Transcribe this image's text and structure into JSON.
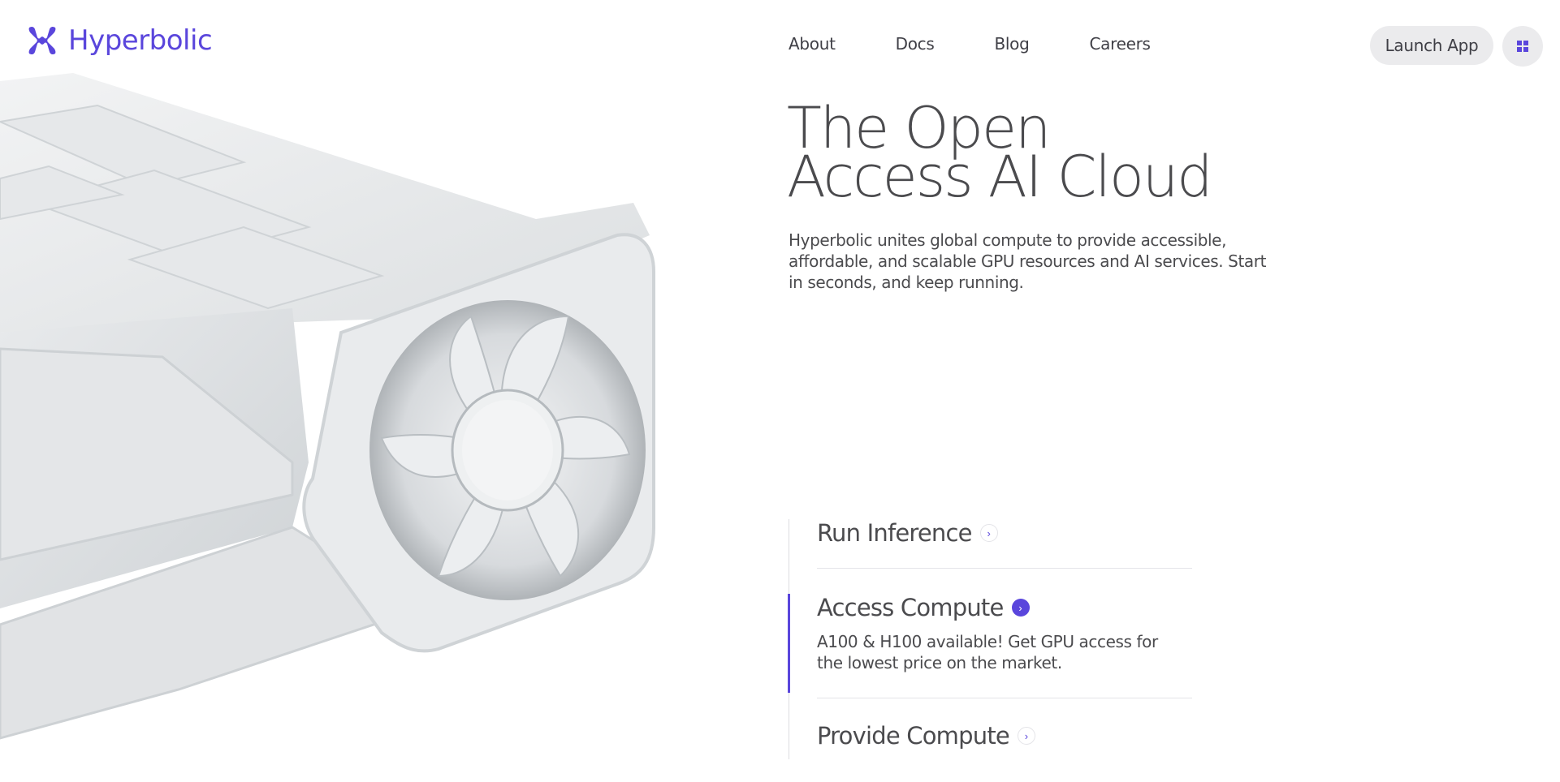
{
  "brand": {
    "name": "Hyperbolic",
    "accent": "#5a46dc"
  },
  "nav": {
    "links": [
      "About",
      "Docs",
      "Blog",
      "Careers"
    ],
    "launch_label": "Launch App"
  },
  "hero": {
    "title_line1": "The Open",
    "title_line2": "Access AI Cloud",
    "description": "Hyperbolic unites global compute to provide accessible, affordable, and scalable GPU resources and AI services. Start in seconds, and keep running."
  },
  "features": [
    {
      "title": "Run Inference",
      "active": false
    },
    {
      "title": "Access Compute",
      "active": true,
      "description": "A100 & H100 available! Get GPU access for the lowest price on the market."
    },
    {
      "title": "Provide Compute",
      "active": false
    }
  ],
  "icons": {
    "logo": "hyperbolic-logo-icon",
    "menu": "grid-menu-icon",
    "chevron": "chevron-right-icon"
  }
}
